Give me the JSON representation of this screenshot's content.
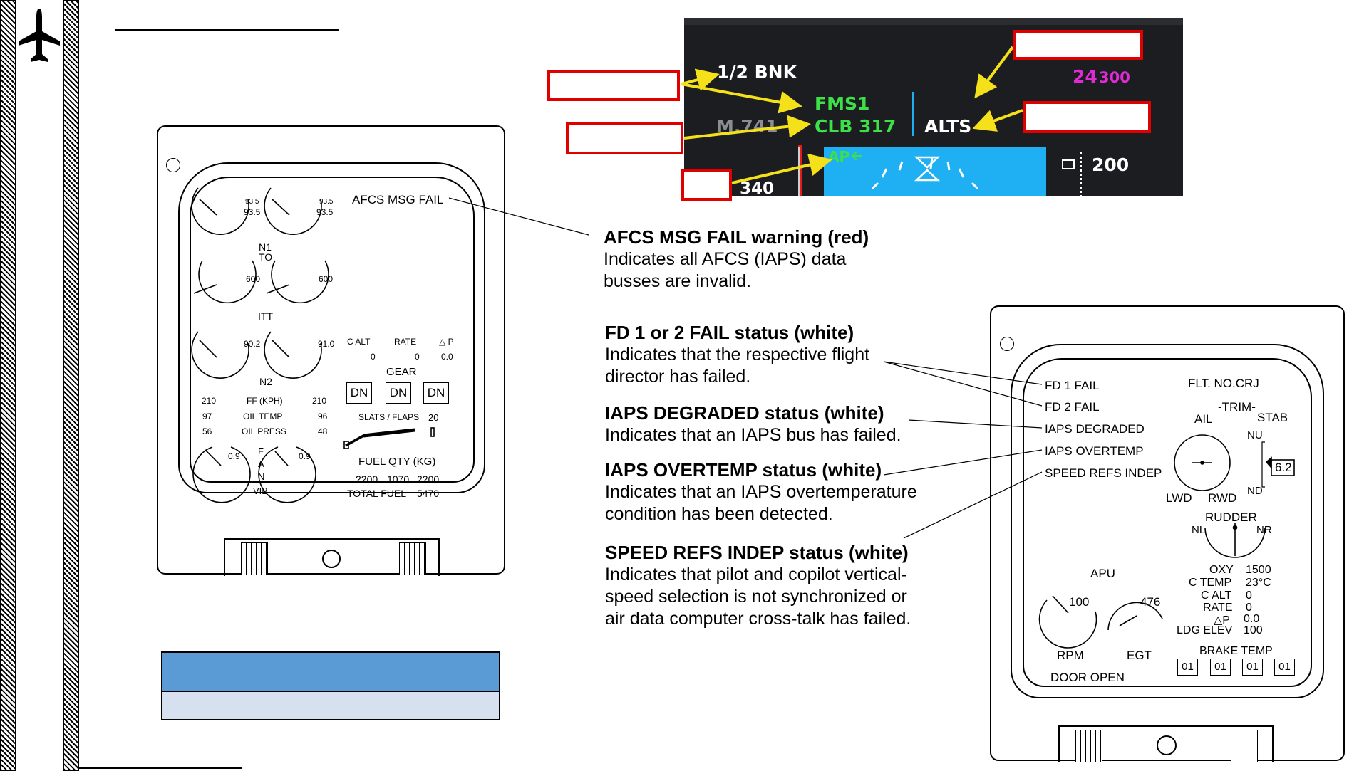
{
  "pfd": {
    "bank_label": "1/2 BNK",
    "fms_label": "FMS1",
    "clb_label": "CLB 317",
    "mach_label": "M.741",
    "alts_label": "ALTS",
    "alt_preselect_a": "24",
    "alt_preselect_b": "300",
    "ap_label": "AP",
    "speed_label": "340",
    "alt_tape_label": "200",
    "colors": {
      "green": "#3ee048",
      "magenta": "#e02ad6",
      "cyan": "#1fb0f4",
      "red_box": "#e00000",
      "bg": "#1b1d20"
    }
  },
  "descriptions": [
    {
      "title": "AFCS MSG FAIL warning (red)",
      "lines": [
        "Indicates all AFCS (IAPS) data",
        "busses are invalid."
      ]
    },
    {
      "title": "FD 1 or 2 FAIL status (white)",
      "lines": [
        "Indicates that the respective flight",
        "director has failed."
      ]
    },
    {
      "title": "IAPS DEGRADED status (white)",
      "lines": [
        "Indicates that an IAPS bus has failed."
      ]
    },
    {
      "title": "IAPS OVERTEMP status (white)",
      "lines": [
        "Indicates that an IAPS overtemperature",
        "condition has been detected."
      ]
    },
    {
      "title": "SPEED REFS INDEP status (white)",
      "lines": [
        "Indicates that pilot and copilot vertical-",
        "speed selection is not synchronized or",
        "air data computer cross-talk has failed."
      ]
    }
  ],
  "eicas_left": {
    "msg": "AFCS MSG FAIL",
    "n1": {
      "left_a": "93.5",
      "left_b": "93.5",
      "right_a": "93.5",
      "right_b": "93.5",
      "label1": "N1",
      "label2": "TO"
    },
    "itt": {
      "left": "600",
      "right": "600",
      "label": "ITT"
    },
    "n2": {
      "left": "90.2",
      "right": "91.0",
      "label": "N2"
    },
    "cabin": {
      "c_alt_label": "C ALT",
      "rate_label": "RATE",
      "dp_label": "△ P",
      "c_alt": "0",
      "rate": "0",
      "dp": "0.0"
    },
    "gear": {
      "label": "GEAR",
      "values": [
        "DN",
        "DN",
        "DN"
      ]
    },
    "ff": {
      "left": "210",
      "label": "FF (KPH)",
      "right": "210"
    },
    "oil_temp": {
      "left": "97",
      "label": "OIL TEMP",
      "right": "96"
    },
    "oil_press": {
      "left": "56",
      "label": "OIL PRESS",
      "right": "48"
    },
    "slats": {
      "label": "SLATS / FLAPS",
      "value": "20"
    },
    "fan_vib": {
      "left": "0.9",
      "right": "0.9",
      "letters": [
        "F",
        "A",
        "N"
      ],
      "label": "VIB"
    },
    "fuel": {
      "label": "FUEL QTY (KG)",
      "values": [
        "2200",
        "1070",
        "2200"
      ],
      "total_label": "TOTAL FUEL",
      "total": "5470"
    }
  },
  "eicas_right": {
    "messages": [
      "FD 1 FAIL",
      "FD 2 FAIL",
      "IAPS DEGRADED",
      "IAPS OVERTEMP",
      "SPEED REFS INDEP"
    ],
    "flt_no": "FLT. NO.CRJ",
    "trim": "-TRIM-",
    "ail": "AIL",
    "stab": "STAB",
    "nu": "NU",
    "nd": "ND",
    "stab_value": "6.2",
    "lwd": "LWD",
    "rwd": "RWD",
    "rudder": "RUDDER",
    "nl": "NL",
    "nr": "NR",
    "apu": "APU",
    "rpm_value": "100",
    "egt_value": "476",
    "rpm": "RPM",
    "egt": "EGT",
    "door": "DOOR OPEN",
    "oxy_label": "OXY",
    "oxy": "1500",
    "ctemp_label": "C TEMP",
    "ctemp": "23°C",
    "calt_label": "C ALT",
    "calt": "0",
    "rate_label": "RATE",
    "rate": "0",
    "dp_label": "△P",
    "dp": "0.0",
    "ldg_label": "LDG ELEV",
    "ldg": "100",
    "brake_label": "BRAKE TEMP",
    "brake_values": [
      "01",
      "01",
      "01",
      "01"
    ]
  },
  "legend_table": {
    "header": "",
    "body": ""
  }
}
